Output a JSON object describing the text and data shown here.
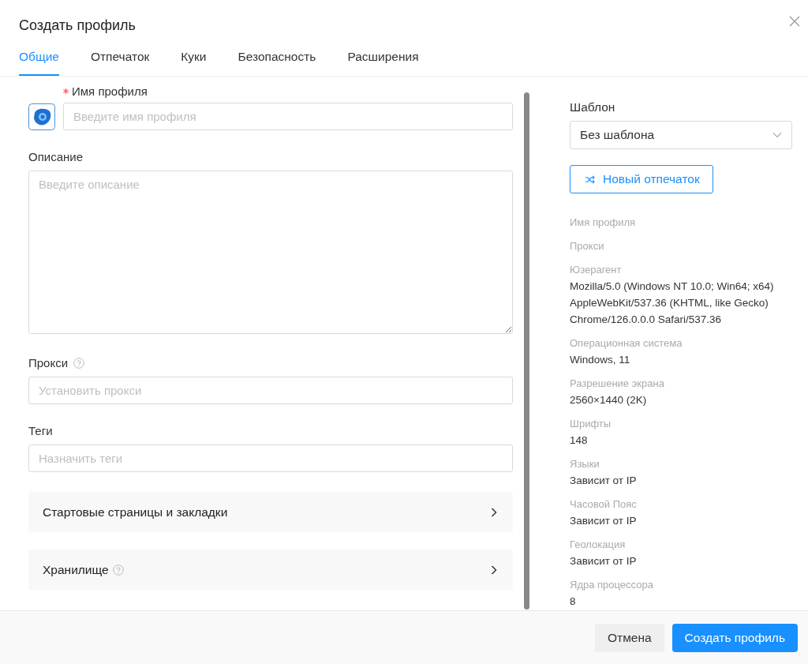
{
  "dialog": {
    "title": "Создать профиль"
  },
  "tabs": [
    {
      "label": "Общие",
      "selected": true
    },
    {
      "label": "Отпечаток",
      "selected": false
    },
    {
      "label": "Куки",
      "selected": false
    },
    {
      "label": "Безопасность",
      "selected": false
    },
    {
      "label": "Расширения",
      "selected": false
    }
  ],
  "fields": [
    {
      "kind": "name",
      "label": "Имя профиля",
      "required": true,
      "help": false,
      "placeholder": "Введите имя профиля"
    },
    {
      "kind": "textarea",
      "label": "Описание",
      "required": false,
      "help": false,
      "placeholder": "Введите описание"
    },
    {
      "kind": "input",
      "label": "Прокси",
      "required": false,
      "help": true,
      "placeholder": "Установить прокси"
    },
    {
      "kind": "input",
      "label": "Теги",
      "required": false,
      "help": false,
      "placeholder": "Назначить теги"
    }
  ],
  "sections": [
    {
      "label": "Стартовые страницы и закладки",
      "help": false
    },
    {
      "label": "Хранилище",
      "help": true
    }
  ],
  "template": {
    "label": "Шаблон",
    "value": "Без шаблона"
  },
  "new_fingerprint_button": "Новый отпечаток",
  "summary": [
    {
      "label": "Имя профиля"
    },
    {
      "label": "Прокси"
    },
    {
      "label": "Юзерагент",
      "value": "Mozilla/5.0 (Windows NT 10.0; Win64; x64) AppleWebKit/537.36 (KHTML, like Gecko) Chrome/126.0.0.0 Safari/537.36"
    },
    {
      "label": "Операционная система",
      "value": "Windows, 11"
    },
    {
      "label": "Разрешение экрана",
      "value": "2560×1440 (2K)"
    },
    {
      "label": "Шрифты",
      "value": "148"
    },
    {
      "label": "Языки",
      "value": "Зависит от IP"
    },
    {
      "label": "Часовой Пояс",
      "value": "Зависит от IP"
    },
    {
      "label": "Геолокация",
      "value": "Зависит от IP"
    },
    {
      "label": "Ядра процессора",
      "value": "8"
    }
  ],
  "buttons": [
    {
      "kind": "secondary",
      "label": "Отмена"
    },
    {
      "kind": "primary",
      "label": "Создать профиль"
    }
  ]
}
